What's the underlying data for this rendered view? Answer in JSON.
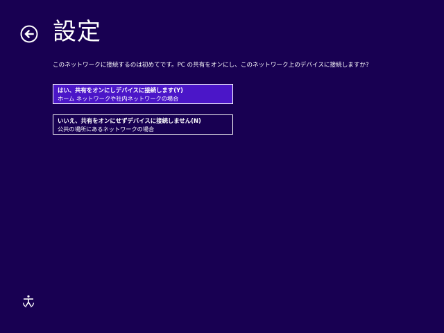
{
  "header": {
    "back_icon": "back-arrow-circle-icon",
    "title": "設定"
  },
  "question": "このネットワークに接続するのは初めてです。PC の共有をオンにし、このネットワーク上のデバイスに接続しますか?",
  "options": [
    {
      "title": "はい、共有をオンにしデバイスに接続します(Y)",
      "subtitle": "ホーム ネットワークや社内ネットワークの場合",
      "selected": true
    },
    {
      "title": "いいえ、共有をオンにせずデバイスに接続しません(N)",
      "subtitle": "公共の場所にあるネットワークの場合",
      "selected": false
    }
  ],
  "footer": {
    "ease_of_access_icon": "ease-of-access-icon"
  },
  "colors": {
    "background": "#180052",
    "selected_option": "#4b16c8",
    "text": "#ffffff"
  }
}
